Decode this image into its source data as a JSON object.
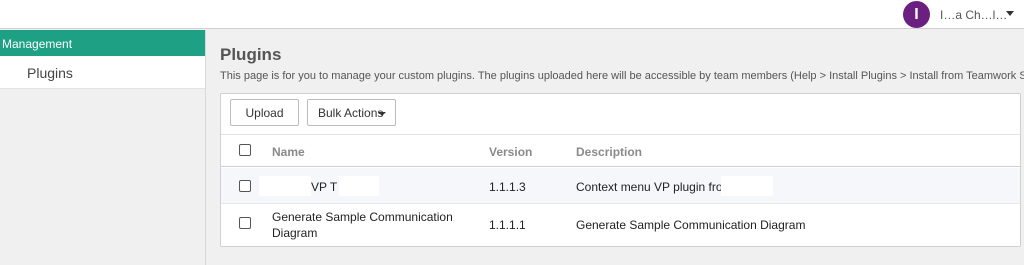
{
  "header": {
    "avatar_initial": "I",
    "username": "I…a Ch…l…"
  },
  "sidebar": {
    "section_label": "Management",
    "items": [
      {
        "label": "Plugins"
      }
    ]
  },
  "main": {
    "title": "Plugins",
    "description": "This page is for you to manage your custom plugins. The plugins uploaded here will be accessible by team members (Help > Install Plugins > Install from Teamwork Server).",
    "toolbar": {
      "upload_label": "Upload",
      "bulk_actions_label": "Bulk Actions"
    },
    "table": {
      "columns": [
        "Name",
        "Version",
        "Description"
      ],
      "rows": [
        {
          "name": "VP T",
          "version": "1.1.1.3",
          "description": "Context menu VP plugin fron"
        },
        {
          "name": "Generate Sample Communication Diagram",
          "version": "1.1.1.1",
          "description": "Generate Sample Communication Diagram"
        }
      ]
    }
  },
  "colors": {
    "accent": "#1ea084",
    "avatar": "#6b1f80"
  }
}
